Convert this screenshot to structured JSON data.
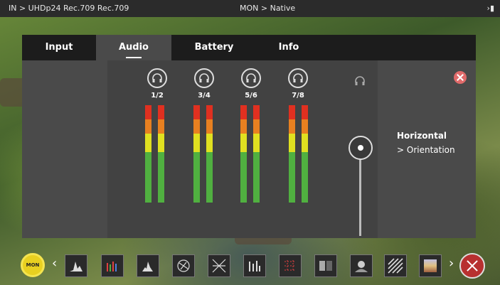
{
  "topbar": {
    "left": "IN > UHDp24 Rec.709 Rec.709",
    "center": "MON  > Native",
    "right": "›▮"
  },
  "tabs": [
    "Input",
    "Audio",
    "Battery",
    "Info"
  ],
  "active_tab": "Audio",
  "channels": [
    "1/2",
    "3/4",
    "5/6",
    "7/8"
  ],
  "orientation": {
    "title": "Horizontal",
    "subtitle": "> Orientation"
  },
  "bottom": {
    "mon_label": "MON",
    "tools": [
      "waveform-icon",
      "vectorscope-icon",
      "histogram-icon",
      "parade-icon",
      "crosshatch-icon",
      "rgb-icon",
      "grid-icon",
      "compare-icon",
      "focus-icon",
      "zebra-icon",
      "false-color-icon"
    ]
  },
  "colors": {
    "accent": "#e8d020",
    "close": "#e06a6a",
    "exit": "#b83030"
  }
}
